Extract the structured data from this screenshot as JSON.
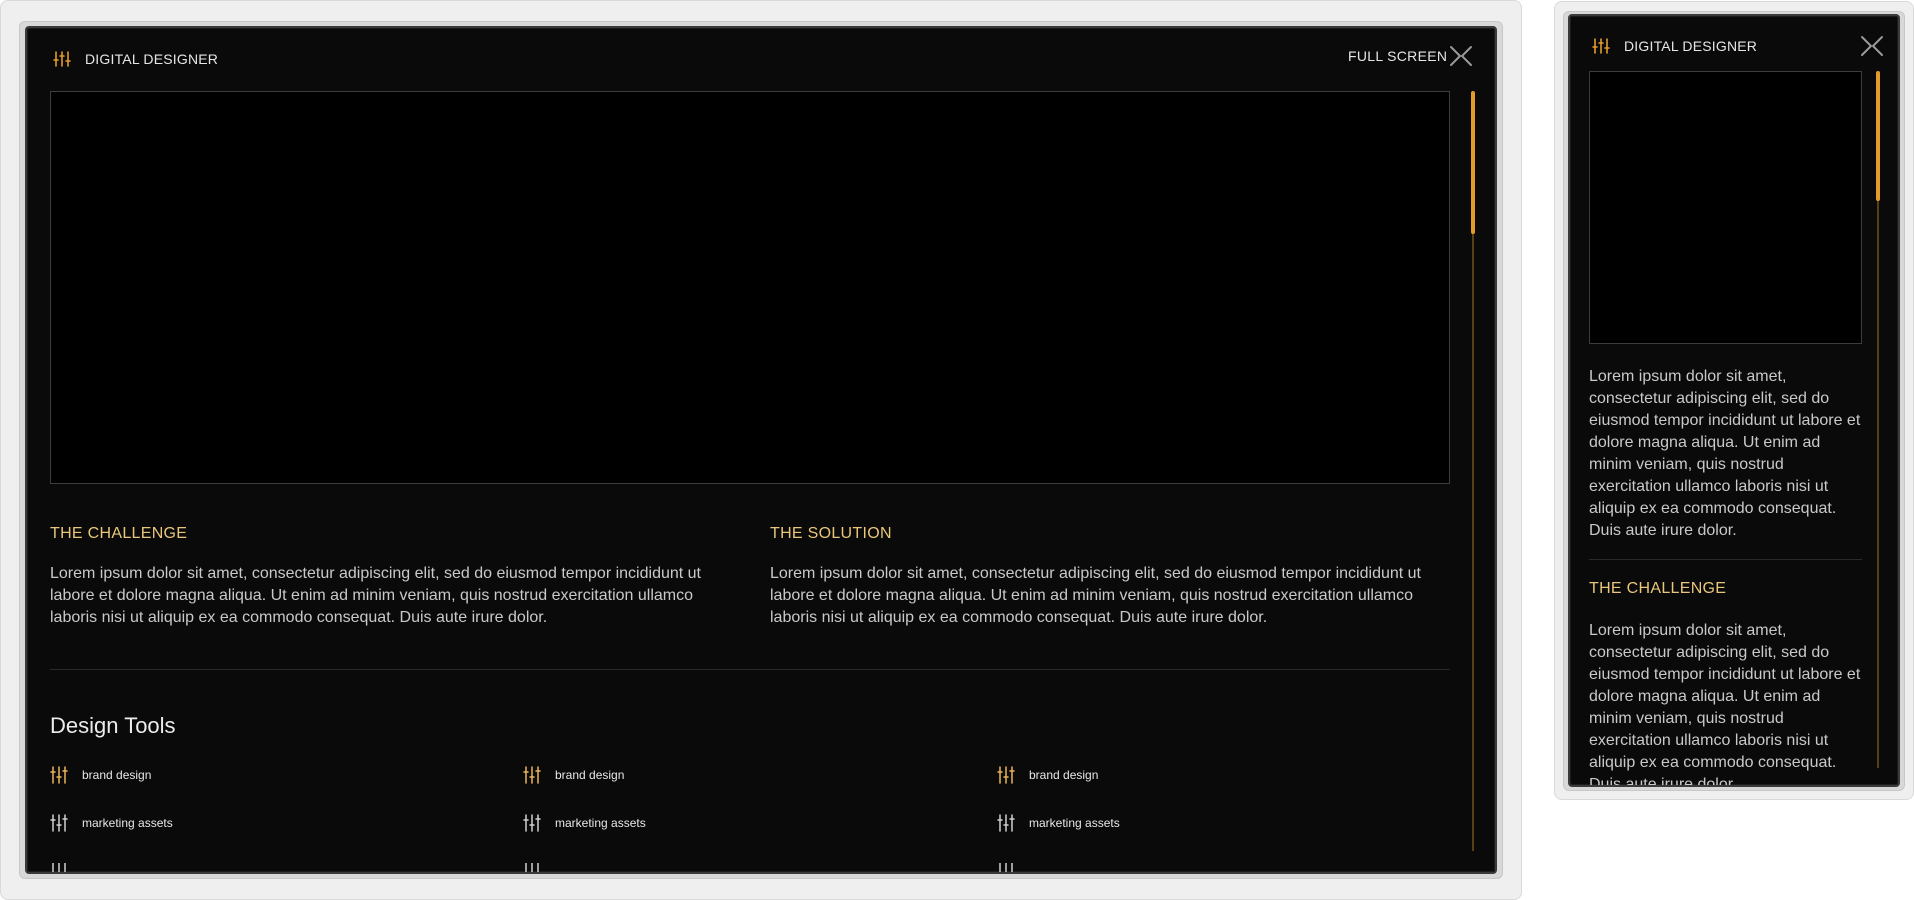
{
  "colors": {
    "accent": "#e9c67a",
    "scroll_thumb": "#e39c2a",
    "background": "#0a0a0a",
    "text": "#c9c9c9"
  },
  "large": {
    "title": "DIGITAL DESIGNER",
    "fullscreen_label": "FULL SCREEN",
    "challenge": {
      "heading": "THE CHALLENGE",
      "text": "Lorem ipsum dolor sit amet, consectetur adipiscing elit, sed do eiusmod tempor incididunt ut labore et dolore magna aliqua. Ut enim ad minim veniam, quis nostrud exercitation ullamco laboris nisi ut aliquip ex ea commodo consequat. Duis aute irure dolor."
    },
    "solution": {
      "heading": "THE SOLUTION",
      "text": "Lorem ipsum dolor sit amet, consectetur adipiscing elit, sed do eiusmod tempor incididunt ut labore et dolore magna aliqua. Ut enim ad minim veniam, quis nostrud exercitation ullamco laboris nisi ut aliquip ex ea commodo consequat. Duis aute irure dolor."
    },
    "tools_title": "Design Tools",
    "tools": [
      {
        "label": "brand design",
        "icon": "tune-icon",
        "highlight": true
      },
      {
        "label": "brand design",
        "icon": "tune-icon",
        "highlight": true
      },
      {
        "label": "brand design",
        "icon": "tune-icon",
        "highlight": true
      },
      {
        "label": "marketing assets",
        "icon": "tune-icon",
        "highlight": false
      },
      {
        "label": "marketing assets",
        "icon": "tune-icon",
        "highlight": false
      },
      {
        "label": "marketing assets",
        "icon": "tune-icon",
        "highlight": false
      }
    ]
  },
  "small": {
    "title": "DIGITAL DESIGNER",
    "intro": "Lorem ipsum dolor sit amet, consectetur adipiscing elit, sed do eiusmod tempor incididunt ut labore et dolore magna aliqua. Ut enim ad minim veniam, quis nostrud exercitation ullamco laboris nisi ut aliquip ex ea commodo consequat. Duis aute irure dolor.",
    "challenge": {
      "heading": "THE CHALLENGE",
      "text": "Lorem ipsum dolor sit amet, consectetur adipiscing elit, sed do eiusmod tempor incididunt ut labore et dolore magna aliqua. Ut enim ad minim veniam, quis nostrud exercitation ullamco laboris nisi ut aliquip ex ea commodo consequat. Duis aute irure dolor."
    }
  }
}
